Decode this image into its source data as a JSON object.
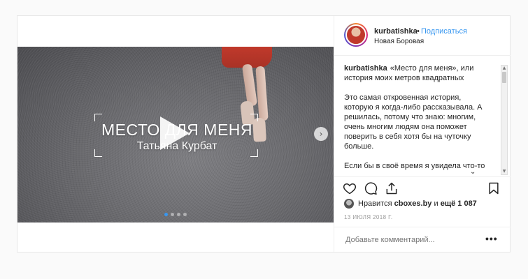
{
  "post": {
    "username": "kurbatishka",
    "follow_separator": "•",
    "follow_label": "Подписаться",
    "location": "Новая Боровая",
    "video": {
      "title": "МЕСТО ДЛЯ МЕНЯ",
      "subtitle": "Татьяна Курбат",
      "carousel_total": 4,
      "carousel_active": 1
    },
    "caption": {
      "username": "kurbatishka",
      "intro": "«Место для меня», или история моих метров квадратных",
      "paragraph1": "Это самая откровенная история, которую я когда-либо рассказывала. А решилась, потому что знаю: многим, очень многим людям она поможет поверить в себя хотя бы на чуточку больше.",
      "paragraph2": "Если бы в своё время я увидела что-то похожее, наверное, вопрос, который по жизни доставлял мне огромный"
    },
    "likes": {
      "prefix": "Нравится",
      "user": "cboxes.by",
      "mid": "и",
      "others": "ещё 1 087"
    },
    "date": "13 ИЮЛЯ 2018 Г.",
    "comment_placeholder": "Добавьте комментарий...",
    "more_label": "•••",
    "next_arrow": "›"
  },
  "icons": {
    "like": "heart-icon",
    "comment": "comment-icon",
    "share": "share-icon",
    "save": "bookmark-icon",
    "play": "play-icon",
    "next": "chevron-right-icon"
  },
  "colors": {
    "link": "#3897f0",
    "dress": "#c0392b"
  }
}
